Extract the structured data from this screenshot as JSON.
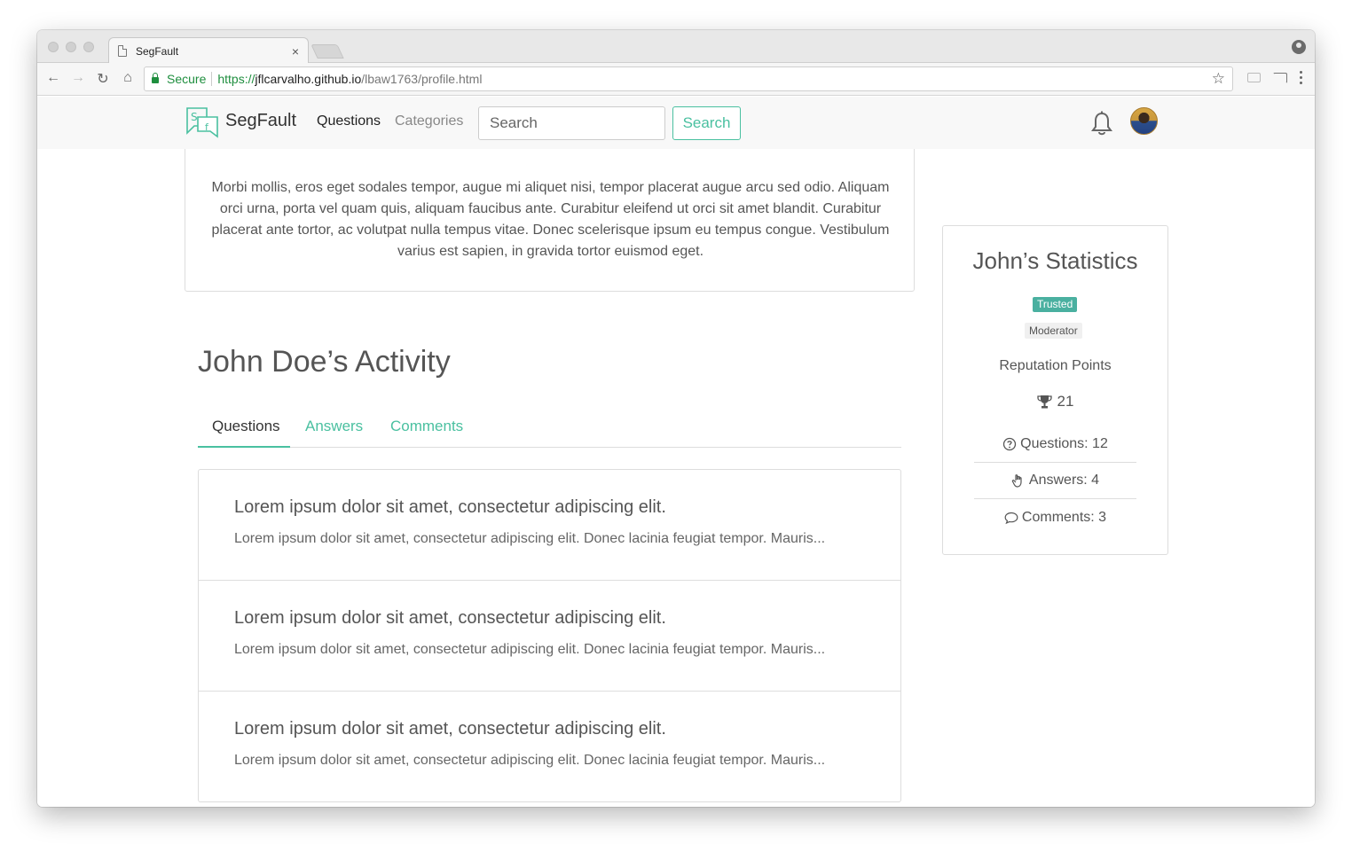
{
  "browser": {
    "tab_title": "SegFault",
    "tab_close": "×",
    "secure_label": "Secure",
    "url_scheme": "https://",
    "url_host": "jflcarvalho.github.io",
    "url_path": "/lbaw1763/profile.html",
    "back": "←",
    "forward": "→",
    "reload": "↻",
    "home": "⌂",
    "star": "☆"
  },
  "navbar": {
    "brand": "SegFault",
    "questions": "Questions",
    "categories": "Categories",
    "search_placeholder": "Search",
    "search_button": "Search"
  },
  "about": {
    "text": "Morbi mollis, eros eget sodales tempor, augue mi aliquet nisi, tempor placerat augue arcu sed odio. Aliquam orci urna, porta vel quam quis, aliquam faucibus ante. Curabitur eleifend ut orci sit amet blandit. Curabitur placerat ante tortor, ac volutpat nulla tempus vitae. Donec scelerisque ipsum eu tempus congue. Vestibulum varius est sapien, in gravida tortor euismod eget."
  },
  "activity": {
    "title": "John Doe’s Activity",
    "tabs": [
      "Questions",
      "Answers",
      "Comments"
    ],
    "items": [
      {
        "title": "Lorem ipsum dolor sit amet, consectetur adipiscing elit.",
        "excerpt": "Lorem ipsum dolor sit amet, consectetur adipiscing elit. Donec lacinia feugiat tempor. Mauris..."
      },
      {
        "title": "Lorem ipsum dolor sit amet, consectetur adipiscing elit.",
        "excerpt": "Lorem ipsum dolor sit amet, consectetur adipiscing elit. Donec lacinia feugiat tempor. Mauris..."
      },
      {
        "title": "Lorem ipsum dolor sit amet, consectetur adipiscing elit.",
        "excerpt": "Lorem ipsum dolor sit amet, consectetur adipiscing elit. Donec lacinia feugiat tempor. Mauris..."
      }
    ]
  },
  "stats": {
    "title": "John’s Statistics",
    "badge_trusted": "Trusted",
    "badge_moderator": "Moderator",
    "reputation_label": "Reputation Points",
    "reputation_value": "21",
    "questions": "Questions: 12",
    "answers": "Answers: 4",
    "comments": "Comments: 3"
  },
  "colors": {
    "accent": "#4ac0a0",
    "trusted_badge": "#4ab0a0",
    "secure_green": "#1e8e3e"
  },
  "icons": [
    "page-icon",
    "lock-icon",
    "star-icon",
    "bell-icon",
    "trophy-icon",
    "question-circle-icon",
    "hand-icon",
    "comment-icon"
  ]
}
